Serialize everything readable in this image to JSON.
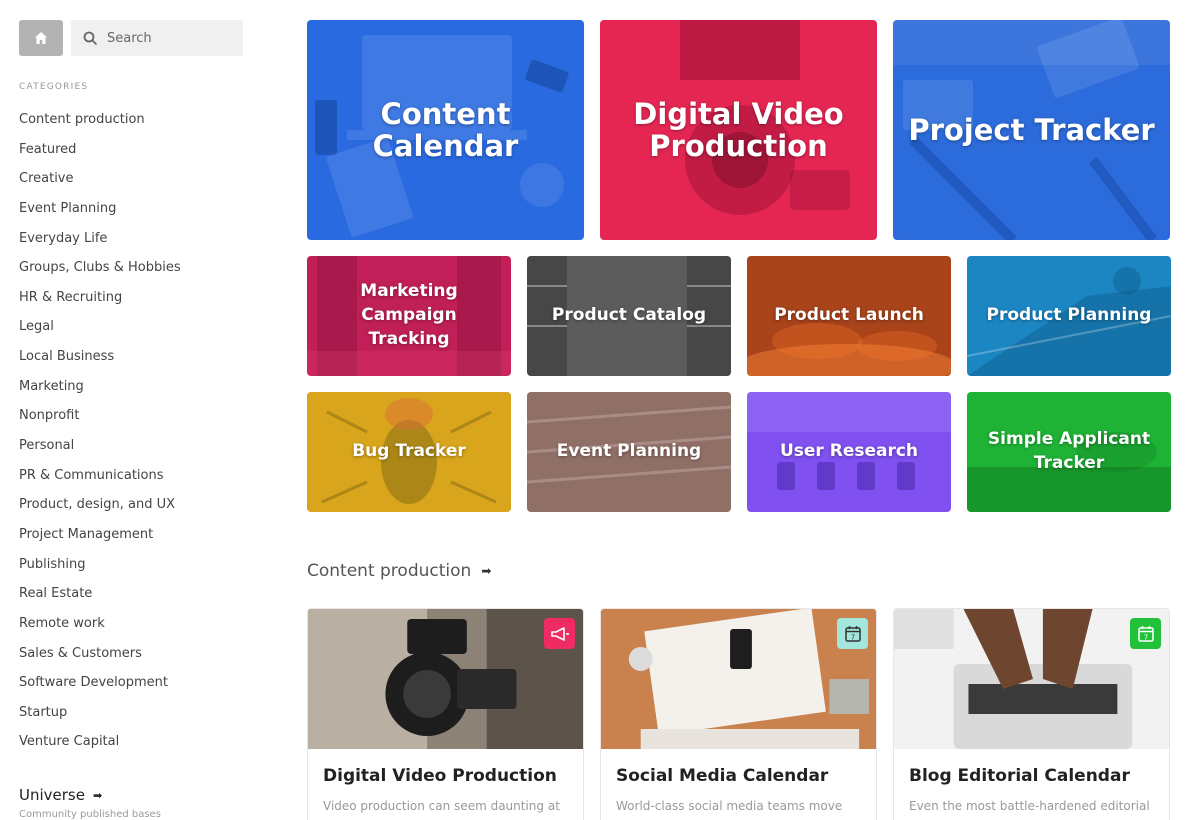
{
  "search": {
    "placeholder": "Search"
  },
  "sidebar": {
    "heading": "CATEGORIES",
    "categories": [
      "Content production",
      "Featured",
      "Creative",
      "Event Planning",
      "Everyday Life",
      "Groups, Clubs & Hobbies",
      "HR & Recruiting",
      "Legal",
      "Local Business",
      "Marketing",
      "Nonprofit",
      "Personal",
      "PR & Communications",
      "Product, design, and UX",
      "Project Management",
      "Publishing",
      "Real Estate",
      "Remote work",
      "Sales & Customers",
      "Software Development",
      "Startup",
      "Venture Capital"
    ],
    "universe": {
      "label": "Universe",
      "subtitle": "Community published bases"
    }
  },
  "featured_large": [
    {
      "title": "Content Calendar",
      "color": "#2a6ae0"
    },
    {
      "title": "Digital Video Production",
      "color": "#e52653"
    },
    {
      "title": "Project Tracker",
      "color": "#2c6bdb"
    }
  ],
  "featured_small": [
    {
      "title": "Marketing Campaign Tracking",
      "color": "#c11f57"
    },
    {
      "title": "Product Catalog",
      "color": "#5c5c5c"
    },
    {
      "title": "Product Launch",
      "color": "#a8431a"
    },
    {
      "title": "Product Planning",
      "color": "#1c86c2"
    },
    {
      "title": "Bug Tracker",
      "color": "#d8a51c"
    },
    {
      "title": "Event Planning",
      "color": "#9c7a72"
    },
    {
      "title": "User Research",
      "color": "#8050f0"
    },
    {
      "title": "Simple Applicant Tracker",
      "color": "#1fb336"
    }
  ],
  "section": {
    "title": "Content production",
    "cards": [
      {
        "title": "Digital Video Production",
        "desc": "Video production can seem daunting at",
        "badge_icon": "megaphone-icon",
        "badge_color": "#ee2b63"
      },
      {
        "title": "Social Media Calendar",
        "desc": "World-class social media teams move",
        "badge_icon": "calendar-icon",
        "badge_color": "#a3e7dc"
      },
      {
        "title": "Blog Editorial Calendar",
        "desc": "Even the most battle-hardened editorial",
        "badge_icon": "calendar-icon",
        "badge_color": "#22c13a"
      }
    ]
  }
}
